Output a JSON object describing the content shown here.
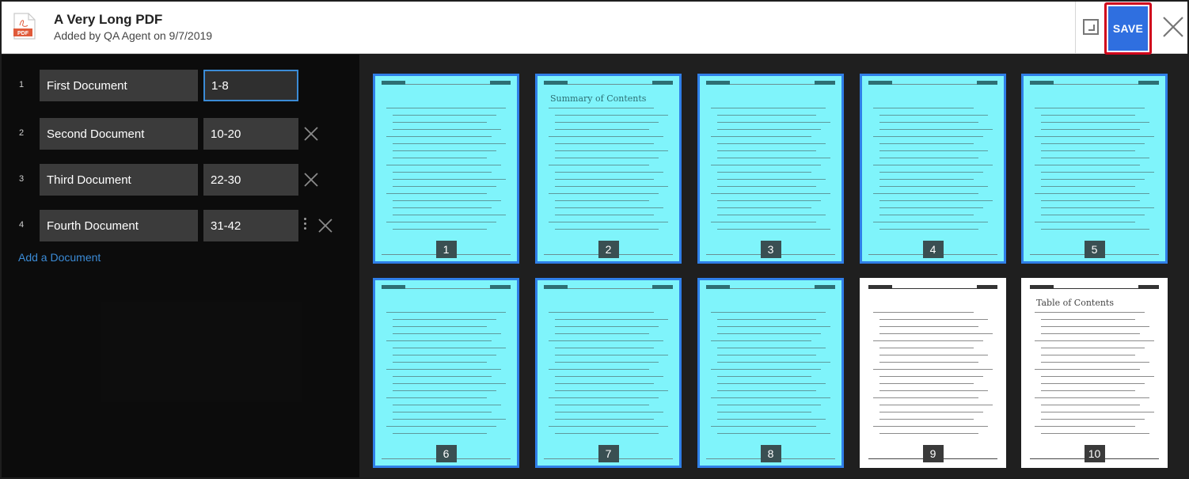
{
  "header": {
    "pdf_icon_label": "PDF",
    "title": "A Very Long PDF",
    "subtitle": "Added by QA Agent on 9/7/2019",
    "save_label": "SAVE"
  },
  "documents": [
    {
      "num": "1",
      "name": "First Document",
      "range": "1-8"
    },
    {
      "num": "2",
      "name": "Second Document",
      "range": "10-20"
    },
    {
      "num": "3",
      "name": "Third Document",
      "range": "22-30"
    },
    {
      "num": "4",
      "name": "Fourth Document",
      "range": "31-42"
    }
  ],
  "add_document_label": "Add a Document",
  "pages": [
    {
      "label": "1",
      "selected": true,
      "heading": ""
    },
    {
      "label": "2",
      "selected": true,
      "heading": "Summary of Contents"
    },
    {
      "label": "3",
      "selected": true,
      "heading": ""
    },
    {
      "label": "4",
      "selected": true,
      "heading": ""
    },
    {
      "label": "5",
      "selected": true,
      "heading": ""
    },
    {
      "label": "6",
      "selected": true,
      "heading": ""
    },
    {
      "label": "7",
      "selected": true,
      "heading": ""
    },
    {
      "label": "8",
      "selected": true,
      "heading": ""
    },
    {
      "label": "9",
      "selected": false,
      "heading": ""
    },
    {
      "label": "10",
      "selected": false,
      "heading": "Table of Contents"
    }
  ],
  "colors": {
    "accent": "#2f6fe0",
    "highlight": "#d0021b",
    "selected_page": "#7ff4fb",
    "link": "#3b8bd6"
  }
}
